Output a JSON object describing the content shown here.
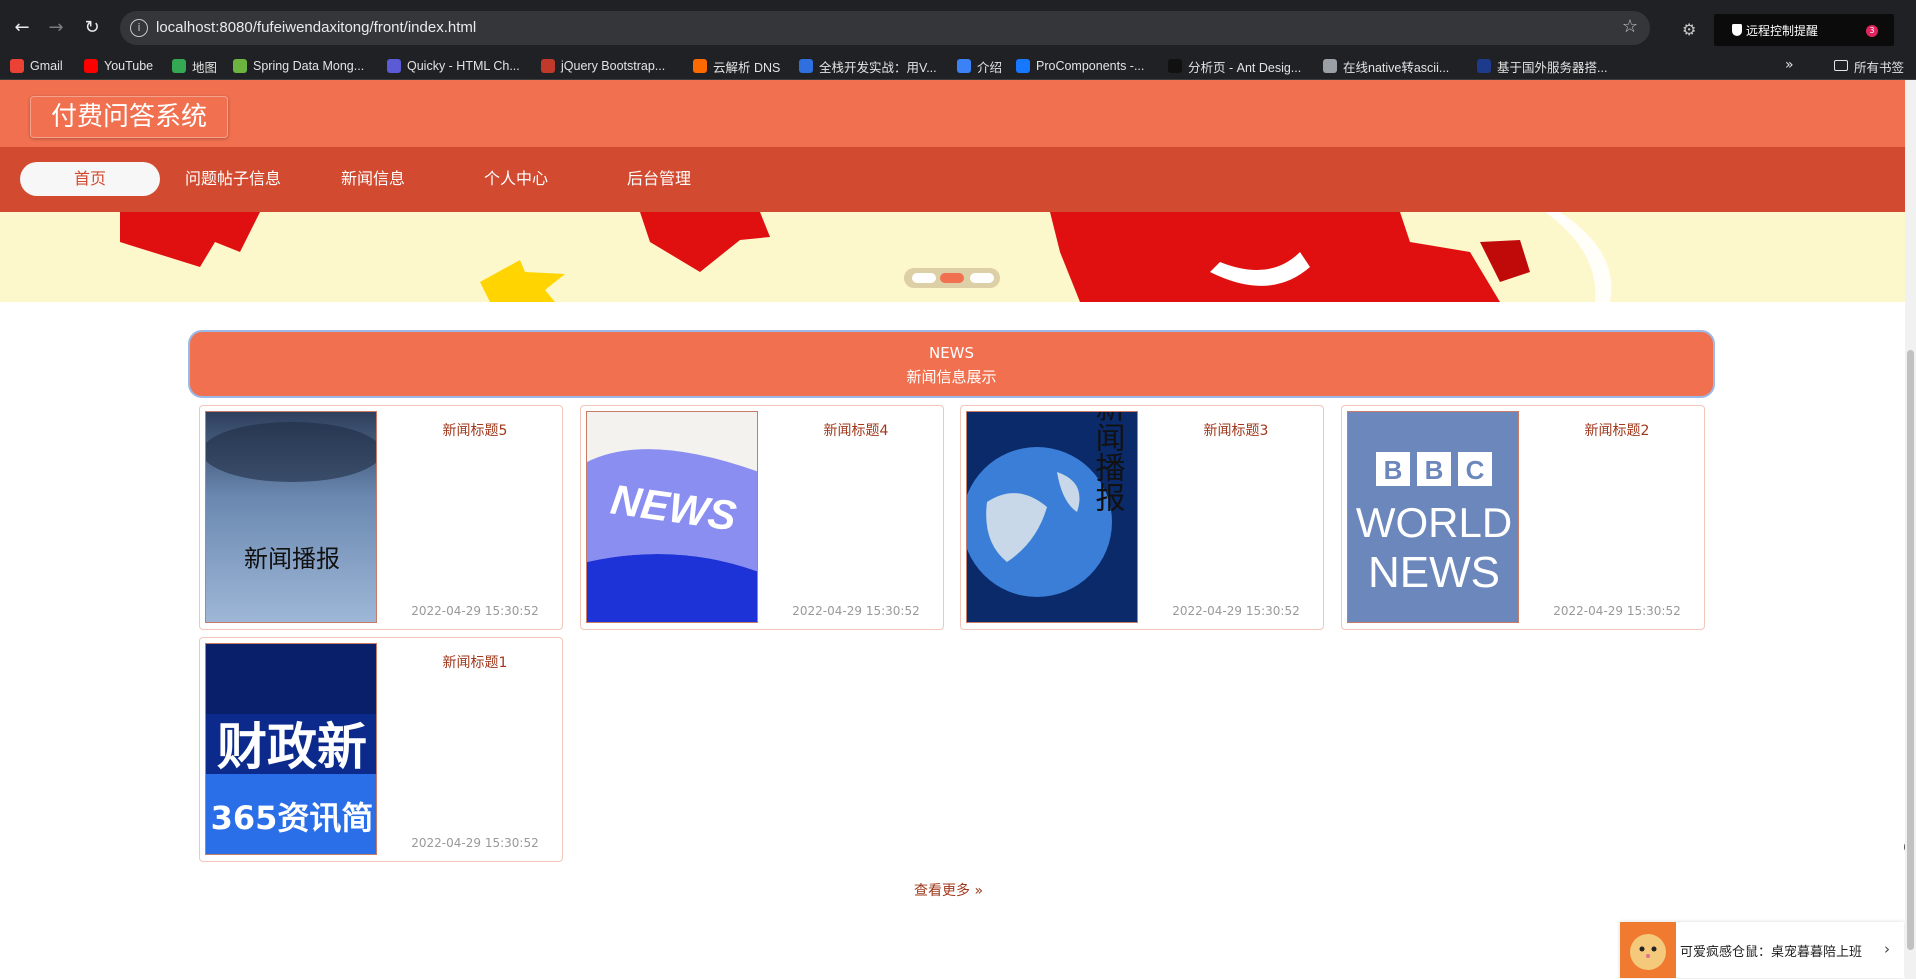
{
  "browser": {
    "url": "localhost:8080/fufeiwendaxitong/front/index.html",
    "remote_popup": "远程控制提醒",
    "remote_badge": "3",
    "bookmarks": [
      {
        "label": "Gmail",
        "color": "#ea4335"
      },
      {
        "label": "YouTube",
        "color": "#ff0000"
      },
      {
        "label": "地图",
        "color": "#34a853"
      },
      {
        "label": "Spring Data Mong...",
        "color": "#6db33f"
      },
      {
        "label": "Quicky - HTML Ch...",
        "color": "#5b5bd6"
      },
      {
        "label": "jQuery Bootstrap...",
        "color": "#c0392b"
      },
      {
        "label": "云解析 DNS",
        "color": "#ff6a00"
      },
      {
        "label": "全栈开发实战：用V...",
        "color": "#2f6fde"
      },
      {
        "label": "介绍",
        "color": "#3b82f6"
      },
      {
        "label": "ProComponents -...",
        "color": "#1677ff"
      },
      {
        "label": "分析页 - Ant Desig...",
        "color": "#111111"
      },
      {
        "label": "在线native转ascii...",
        "color": "#9aa0a6"
      },
      {
        "label": "基于国外服务器搭...",
        "color": "#1e3a8a"
      }
    ],
    "bookmarks_folder": "所有书签"
  },
  "site": {
    "logo": "付费问答系统",
    "nav": [
      "首页",
      "问题帖子信息",
      "新闻信息",
      "个人中心",
      "后台管理"
    ],
    "active_nav": 0
  },
  "news_section": {
    "title_en": "NEWS",
    "title_cn": "新闻信息展示",
    "items": [
      {
        "title": "新闻标题5",
        "date": "2022-04-29 15:30:52",
        "thumb_text": "新闻播报"
      },
      {
        "title": "新闻标题4",
        "date": "2022-04-29 15:30:52",
        "thumb_text": "NEWS"
      },
      {
        "title": "新闻标题3",
        "date": "2022-04-29 15:30:52",
        "thumb_text": "新闻播报"
      },
      {
        "title": "新闻标题2",
        "date": "2022-04-29 15:30:52",
        "thumb_text": "BBC WORLD NEWS"
      },
      {
        "title": "新闻标题1",
        "date": "2022-04-29 15:30:52",
        "thumb_text": "财政新 365资讯简"
      }
    ],
    "more_label": "查看更多"
  },
  "pet_widget": {
    "text": "可爱疯感仓鼠：桌宠暮暮陪上班"
  },
  "colors": {
    "header": "#f07050",
    "nav": "#d24b30",
    "accent_text": "#a0381c"
  }
}
